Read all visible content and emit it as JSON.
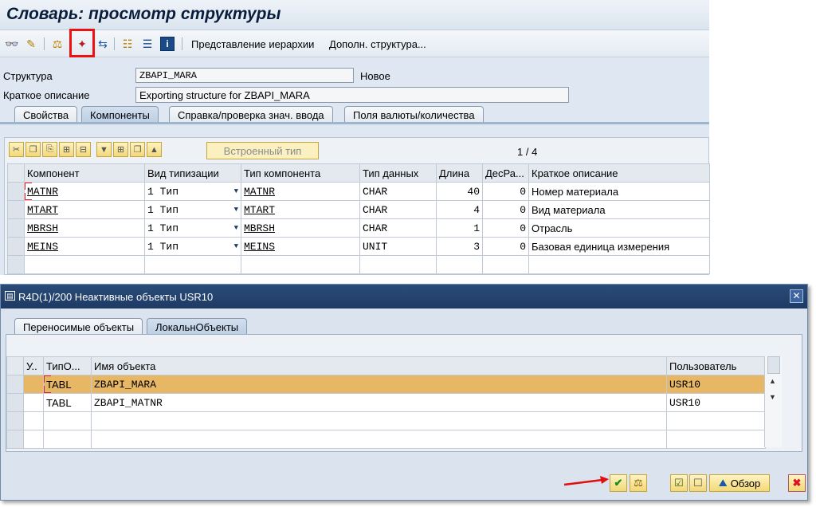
{
  "window": {
    "title": "Словарь: просмотр структуры"
  },
  "toolbar": {
    "icons": [
      "glasses-icon",
      "toggle-icon",
      "hierarchy-icon",
      "activate-icon",
      "where-used-icon",
      "object-list-icon",
      "navigation-icon",
      "info-icon"
    ],
    "btn_hierarchy": "Представление иерархии",
    "btn_append": "Дополн. структура..."
  },
  "header": {
    "structure_label": "Структура",
    "structure_value": "ZBAPI_MARA",
    "status": "Новое",
    "desc_label": "Краткое описание",
    "desc_value": "Exporting structure for ZBAPI_MARA"
  },
  "tabs": [
    {
      "label": "Свойства",
      "active": false
    },
    {
      "label": "Компоненты",
      "active": true
    },
    {
      "label": "Справка/проверка знач. ввода",
      "active": false
    },
    {
      "label": "Поля валюты/количества",
      "active": false
    }
  ],
  "table_toolbar": {
    "embedded_type": "Встроенный тип",
    "page": "1 / 4"
  },
  "components": {
    "columns": [
      "Компонент",
      "Вид типизации",
      "Тип компонента",
      "Тип данных",
      "Длина",
      "ДесРа...",
      "Краткое описание"
    ],
    "rows": [
      {
        "component": "MATNR",
        "typing": "1 Тип",
        "comp_type": "MATNR",
        "data_type": "CHAR",
        "length": "40",
        "decimals": "0",
        "description": "Номер материала"
      },
      {
        "component": "MTART",
        "typing": "1 Тип",
        "comp_type": "MTART",
        "data_type": "CHAR",
        "length": "4",
        "decimals": "0",
        "description": "Вид материала"
      },
      {
        "component": "MBRSH",
        "typing": "1 Тип",
        "comp_type": "MBRSH",
        "data_type": "CHAR",
        "length": "1",
        "decimals": "0",
        "description": "Отрасль"
      },
      {
        "component": "MEINS",
        "typing": "1 Тип",
        "comp_type": "MEINS",
        "data_type": "UNIT",
        "length": "3",
        "decimals": "0",
        "description": "Базовая единица измерения"
      }
    ]
  },
  "dialog": {
    "title": "R4D(1)/200 Неактивные объекты USR10",
    "tabs": [
      {
        "label": "Переносимые объекты",
        "active": false
      },
      {
        "label": "ЛокальнОбъекты",
        "active": true
      }
    ],
    "columns": [
      "У..",
      "ТипО...",
      "Имя объекта",
      "Пользователь"
    ],
    "rows": [
      {
        "status": "",
        "type": "TABL",
        "name": "ZBAPI_MARA",
        "user": "USR10",
        "selected": true
      },
      {
        "status": "",
        "type": "TABL",
        "name": "ZBAPI_MATNR",
        "user": "USR10",
        "selected": false
      }
    ],
    "footer": {
      "overview": "Обзор"
    }
  },
  "colors": {
    "title_bar": "#1d3a63",
    "accent_red": "#ee1111",
    "selected_row": "#e8b766",
    "button_yellow": "#f2d877"
  }
}
